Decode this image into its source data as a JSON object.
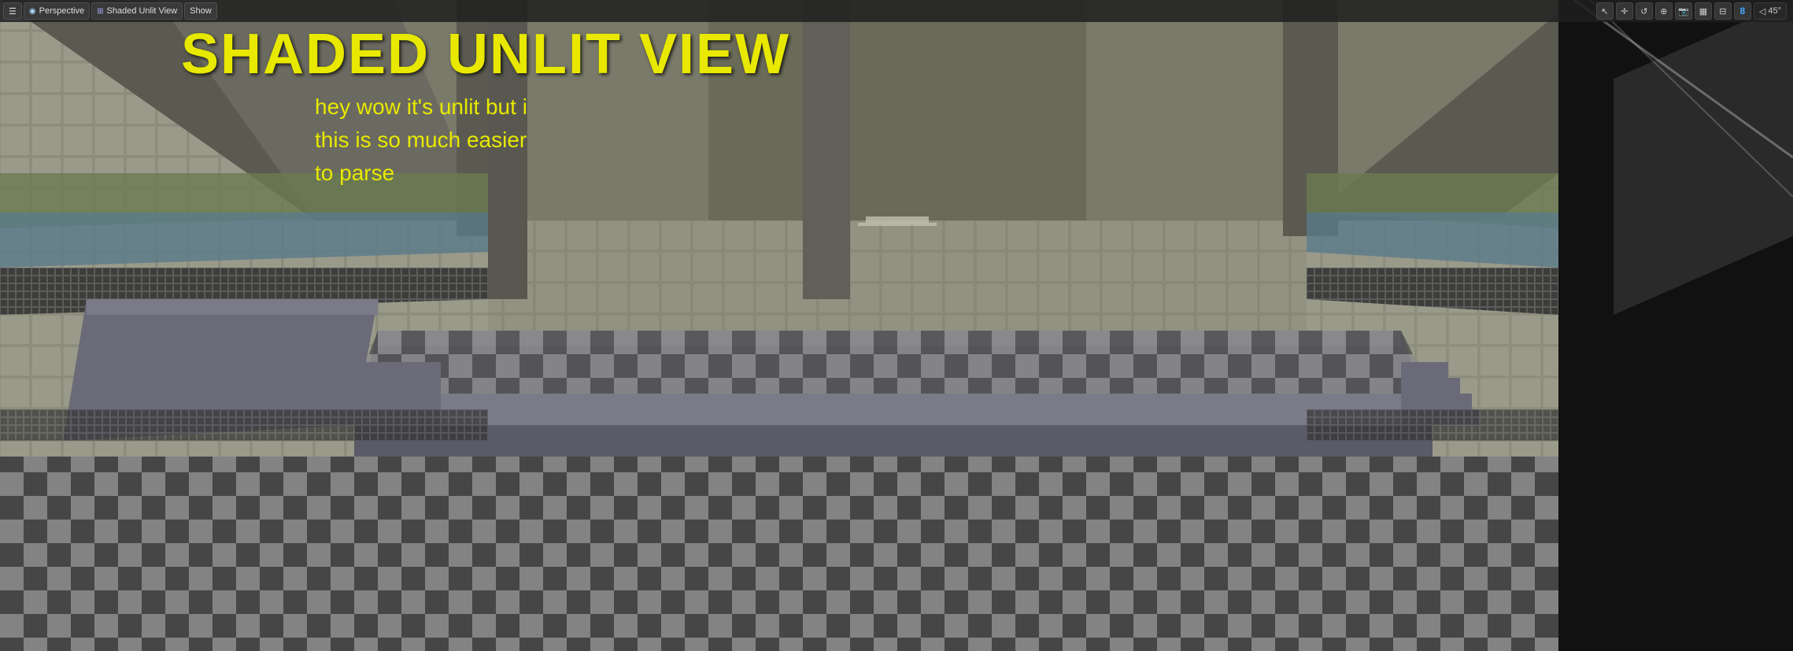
{
  "toolbar": {
    "menu_icon": "☰",
    "perspective_label": "Perspective",
    "shading_label": "Shaded Unlit View",
    "show_label": "Show",
    "icons_right": [
      "↖",
      "+",
      "↺",
      "⊕",
      "⊞",
      "⊟",
      "▦"
    ],
    "layer_count": "8",
    "angle_icon": "◁",
    "angle_value": "45°"
  },
  "overlay": {
    "title": "SHADED UNLIT VIEW",
    "subtitle_line1": "hey wow it's unlit but i",
    "subtitle_line2": "this is so much easier",
    "subtitle_line3": "to parse"
  },
  "colors": {
    "yellow_text": "#e8e800",
    "toolbar_bg": "rgba(30,30,30,0.85)",
    "accent_blue": "#4a7ab5"
  }
}
